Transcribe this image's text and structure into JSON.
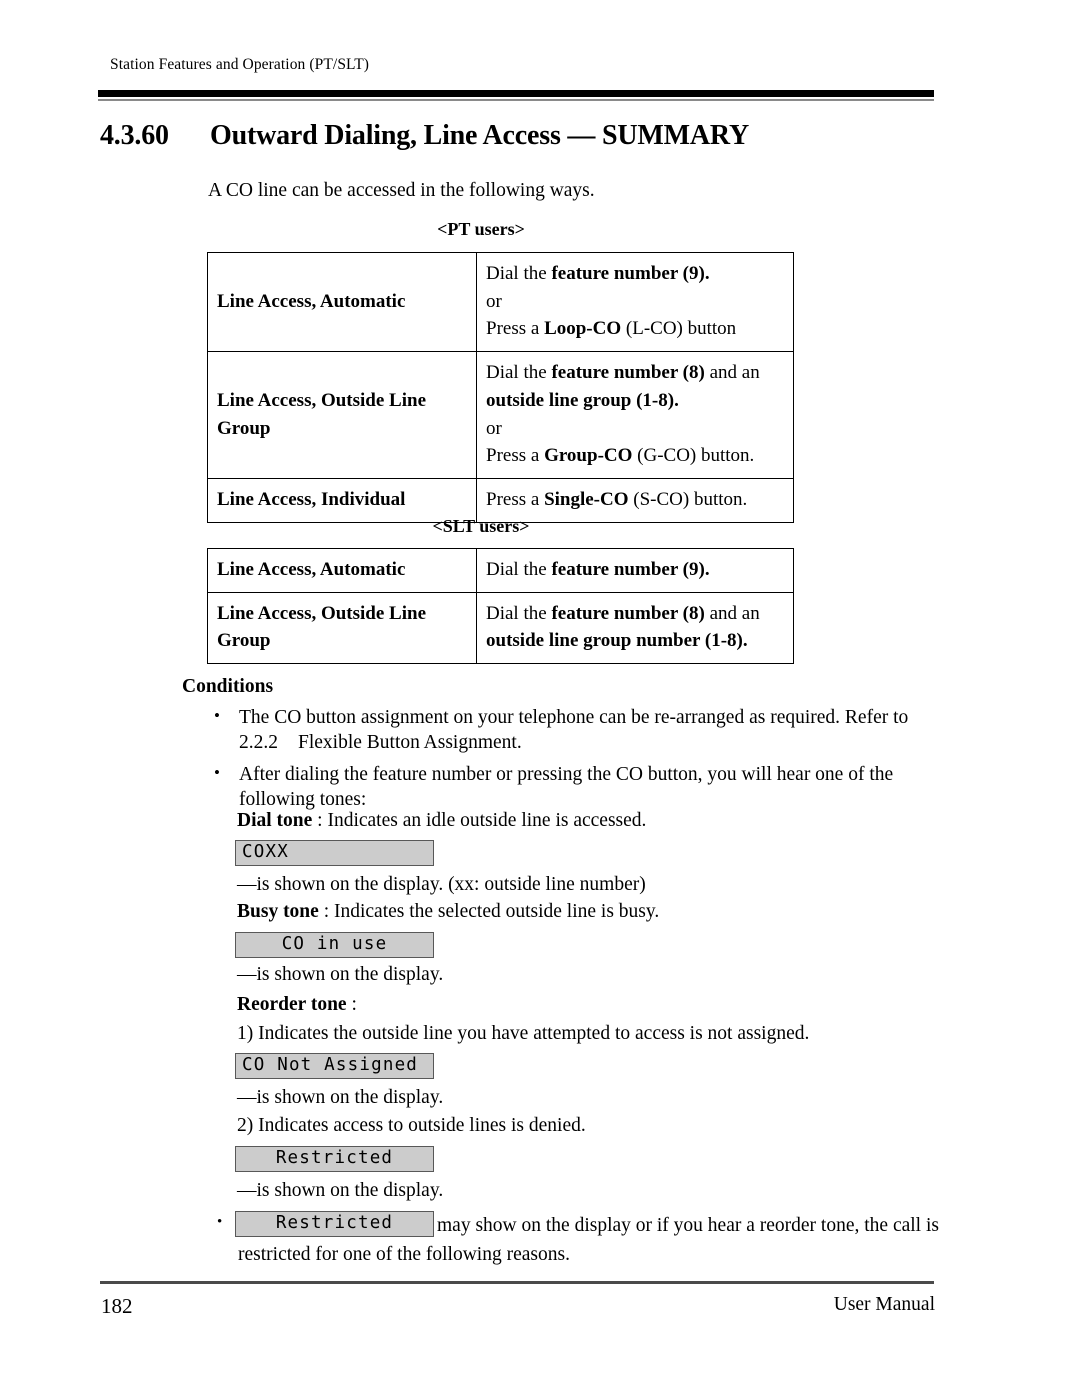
{
  "header": {
    "running_header": "Station Features and Operation (PT/SLT)"
  },
  "title": {
    "number": "4.3.60",
    "text": "Outward Dialing, Line Access — SUMMARY"
  },
  "intro": "A CO line can be accessed in the following ways.",
  "pt_table": {
    "caption": "<PT users>",
    "rows": [
      {
        "label": "Line Access, Automatic",
        "lines": [
          {
            "pre": "Dial the ",
            "bold": "feature number (9).",
            "post": ""
          },
          {
            "pre": "or",
            "bold": "",
            "post": ""
          },
          {
            "pre": "Press a ",
            "bold": "Loop-CO",
            "post": " (L-CO) button"
          }
        ]
      },
      {
        "label": "Line Access, Outside Line Group",
        "lines": [
          {
            "pre": "Dial the ",
            "bold": "feature number (8)",
            "post": " and an"
          },
          {
            "pre": "",
            "bold": "outside line group (1-8).",
            "post": ""
          },
          {
            "pre": "or",
            "bold": "",
            "post": ""
          },
          {
            "pre": "Press a ",
            "bold": "Group-CO",
            "post": " (G-CO) button."
          }
        ]
      },
      {
        "label": "Line Access, Individual",
        "lines": [
          {
            "pre": "Press a ",
            "bold": "Single-CO",
            "post": " (S-CO) button."
          }
        ]
      }
    ]
  },
  "slt_table": {
    "caption": "<SLT users>",
    "rows": [
      {
        "label": "Line Access, Automatic",
        "lines": [
          {
            "pre": "Dial the ",
            "bold": "feature number (9).",
            "post": ""
          }
        ]
      },
      {
        "label": "Line Access, Outside Line Group",
        "lines": [
          {
            "pre": "Dial the ",
            "bold": "feature number (8)",
            "post": " and an"
          },
          {
            "pre": "",
            "bold": "outside line group number (1-8).",
            "post": ""
          }
        ]
      }
    ]
  },
  "conditions": {
    "title": "Conditions",
    "bullet_marker": "•",
    "items": [
      {
        "line1": "The CO button assignment on your telephone can be re-arranged as required. Refer to",
        "line2_ref": "2.2.2",
        "line2_text": "Flexible Button Assignment."
      },
      {
        "line1": "After dialing the feature number or pressing the CO button, you will hear one of the",
        "line2_ref": "",
        "line2_text": "following tones:"
      }
    ]
  },
  "tones": {
    "dial": {
      "label": "Dial tone",
      "desc": " : Indicates an idle outside line is accessed.",
      "lcd": "COXX",
      "lcd_align": "left",
      "after": "—is shown on the display. (xx: outside line number)"
    },
    "busy": {
      "label": "Busy tone",
      "desc": " : Indicates the selected outside line is busy.",
      "lcd": "CO in use",
      "lcd_align": "center",
      "after": "—is shown on the display."
    },
    "reorder": {
      "label": "Reorder tone",
      "desc": " :",
      "item1": "1) Indicates the outside line you have attempted to access is not assigned.",
      "lcd1": "CO Not Assigned",
      "lcd1_align": "left",
      "after1": "—is shown on the display.",
      "item2": "2) Indicates access to outside lines is denied.",
      "lcd2": "Restricted",
      "lcd2_align": "center",
      "after2": "—is shown on the display."
    }
  },
  "last_bullet": {
    "marker": "•",
    "lcd": "Restricted",
    "lcd_align": "center",
    "tail": "may show on the display or if you hear a reorder tone, the call is",
    "second_line": "restricted for one of the following reasons."
  },
  "footer": {
    "page_number": "182",
    "manual_label": "User Manual"
  }
}
